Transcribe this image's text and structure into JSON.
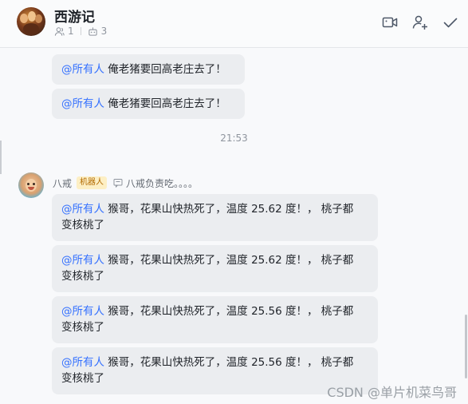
{
  "header": {
    "title": "西游记",
    "member_count": "1",
    "bot_count": "3"
  },
  "messages_top": [
    {
      "mention": "@所有人",
      "text": " 俺老猪要回高老庄去了！"
    },
    {
      "mention": "@所有人",
      "text": " 俺老猪要回高老庄去了！"
    }
  ],
  "time_separator": "21:53",
  "sender": {
    "name": "八戒",
    "badge": "机器人",
    "status": "八戒负责吃。。。。"
  },
  "messages_bot": [
    {
      "mention": "@所有人",
      "text": " 猴哥，花果山快热死了，温度 25.62 度！， 桃子都",
      "text2": "变核桃了"
    },
    {
      "mention": "@所有人",
      "text": " 猴哥，花果山快热死了，温度 25.62 度！， 桃子都",
      "text2": "变核桃了"
    },
    {
      "mention": "@所有人",
      "text": " 猴哥，花果山快热死了，温度 25.56 度！， 桃子都",
      "text2": "变核桃了"
    },
    {
      "mention": "@所有人",
      "text": " 猴哥，花果山快热死了，温度 25.56 度！， 桃子都",
      "text2": "变核桃了"
    }
  ],
  "watermark": "CSDN @单片机菜鸟哥",
  "icons": {
    "members": "person-icon",
    "bots": "robot-icon",
    "video": "video-call-icon",
    "add_member": "add-member-icon",
    "done": "check-icon"
  }
}
